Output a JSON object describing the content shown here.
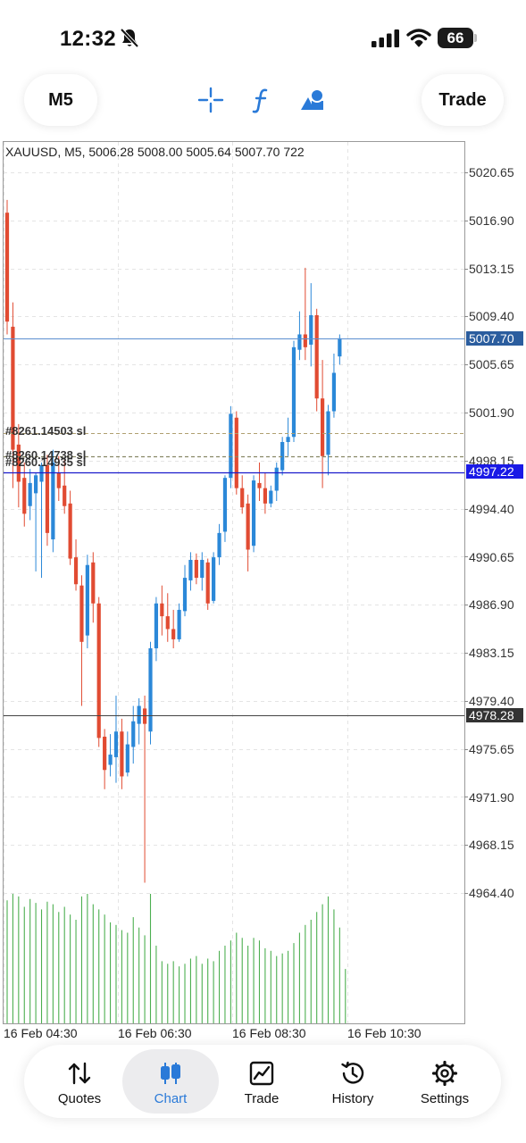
{
  "status_bar": {
    "time": "12:32",
    "battery": "66",
    "icons": [
      "bell-slash-icon",
      "signal-icon",
      "wifi-icon",
      "battery-icon"
    ]
  },
  "toolbar": {
    "timeframe": "M5",
    "trade_label": "Trade",
    "tools": [
      "crosshair-icon",
      "indicator-icon",
      "objects-icon"
    ],
    "accent": "#2a7ad8"
  },
  "chart": {
    "header": "XAUUSD, M5, 5006.28 5008.00 5005.64 5007.70 722",
    "price_levels": [
      "5020.65",
      "5016.90",
      "5013.15",
      "5009.40",
      "5005.65",
      "5001.90",
      "4998.15",
      "4994.40",
      "4990.65",
      "4986.90",
      "4983.15",
      "4979.40",
      "4975.65",
      "4971.90",
      "4968.15",
      "4964.40"
    ],
    "bid_price": "5007.70",
    "order_price": "4997.22",
    "stop_price": "4978.28",
    "time_labels": [
      "16 Feb 04:30",
      "16 Feb 06:30",
      "16 Feb 08:30",
      "16 Feb 10:30"
    ],
    "order_labels": [
      "#8261.14503 sl",
      "#8260.14738 sl",
      "#8260.14935 sl"
    ],
    "colors": {
      "bull": "#2b88d8",
      "bear": "#e14b32",
      "volume": "#4caf50",
      "bid_line": "#5b8fd0",
      "order_line": "#1a1acc",
      "stop_line": "#444444",
      "order_tag": "#1a1ae6",
      "bid_tag": "#2b5d9e",
      "stop_tag": "#333333"
    }
  },
  "chart_data": {
    "type": "candlestick",
    "symbol": "XAUUSD",
    "timeframe": "M5",
    "ohlc_last": {
      "open": 5006.28,
      "high": 5008.0,
      "low": 5005.64,
      "close": 5007.7,
      "volume": 722
    },
    "ylim": [
      4962.0,
      5024.0
    ],
    "candles": [
      {
        "o": 5017.5,
        "h": 5018.5,
        "c": 5009.0,
        "l": 5008.0
      },
      {
        "o": 5008.6,
        "h": 5010.5,
        "c": 4999.0,
        "l": 4996.0
      },
      {
        "o": 4999.4,
        "h": 5001.0,
        "c": 4996.5,
        "l": 4994.5
      },
      {
        "o": 4996.8,
        "h": 4998.0,
        "c": 4994.0,
        "l": 4993.0
      },
      {
        "o": 4994.6,
        "h": 4997.5,
        "c": 4996.4,
        "l": 4993.5
      },
      {
        "o": 4995.6,
        "h": 4997.2,
        "c": 4997.0,
        "l": 4989.5
      },
      {
        "o": 4996.5,
        "h": 4998.0,
        "c": 4997.8,
        "l": 4989.0
      },
      {
        "o": 4997.8,
        "h": 4998.6,
        "c": 4992.5,
        "l": 4991.5
      },
      {
        "o": 4992.0,
        "h": 4999.0,
        "c": 4998.0,
        "l": 4991.0
      },
      {
        "o": 4997.2,
        "h": 4998.5,
        "c": 4996.0,
        "l": 4995.0
      },
      {
        "o": 4996.2,
        "h": 4998.2,
        "c": 4994.6,
        "l": 4994.0
      },
      {
        "o": 4994.8,
        "h": 4995.8,
        "c": 4990.5,
        "l": 4990.0
      },
      {
        "o": 4990.6,
        "h": 4992.0,
        "c": 4988.5,
        "l": 4988.0
      },
      {
        "o": 4988.4,
        "h": 4989.2,
        "c": 4984.0,
        "l": 4979.0
      },
      {
        "o": 4984.5,
        "h": 4990.8,
        "c": 4990.0,
        "l": 4983.5
      },
      {
        "o": 4990.2,
        "h": 4991.0,
        "c": 4987.0,
        "l": 4985.5
      },
      {
        "o": 4987.0,
        "h": 4987.5,
        "c": 4976.5,
        "l": 4975.8
      },
      {
        "o": 4976.6,
        "h": 4977.2,
        "c": 4974.0,
        "l": 4972.5
      },
      {
        "o": 4974.4,
        "h": 4976.8,
        "c": 4975.2,
        "l": 4973.5
      },
      {
        "o": 4975.0,
        "h": 4979.8,
        "c": 4977.0,
        "l": 4973.0
      },
      {
        "o": 4977.0,
        "h": 4978.0,
        "c": 4973.5,
        "l": 4972.5
      },
      {
        "o": 4973.8,
        "h": 4977.0,
        "c": 4976.0,
        "l": 4973.5
      },
      {
        "o": 4975.8,
        "h": 4979.0,
        "c": 4977.8,
        "l": 4974.5
      },
      {
        "o": 4977.6,
        "h": 4979.6,
        "c": 4979.0,
        "l": 4976.0
      },
      {
        "o": 4978.8,
        "h": 4979.8,
        "c": 4977.6,
        "l": 4965.2
      },
      {
        "o": 4977.0,
        "h": 4984.0,
        "c": 4983.5,
        "l": 4976.0
      },
      {
        "o": 4983.5,
        "h": 4987.5,
        "c": 4987.0,
        "l": 4982.5
      },
      {
        "o": 4987.0,
        "h": 4988.4,
        "c": 4986.0,
        "l": 4984.5
      },
      {
        "o": 4986.0,
        "h": 4987.8,
        "c": 4985.0,
        "l": 4984.0
      },
      {
        "o": 4985.0,
        "h": 4986.5,
        "c": 4984.2,
        "l": 4983.5
      },
      {
        "o": 4984.2,
        "h": 4987.0,
        "c": 4986.5,
        "l": 4984.0
      },
      {
        "o": 4986.4,
        "h": 4990.0,
        "c": 4989.0,
        "l": 4986.0
      },
      {
        "o": 4988.8,
        "h": 4991.0,
        "c": 4990.4,
        "l": 4988.0
      },
      {
        "o": 4990.4,
        "h": 4990.9,
        "c": 4989.0,
        "l": 4988.5
      },
      {
        "o": 4989.0,
        "h": 4991.0,
        "c": 4990.4,
        "l": 4988.0
      },
      {
        "o": 4990.2,
        "h": 4990.5,
        "c": 4987.0,
        "l": 4986.5
      },
      {
        "o": 4987.2,
        "h": 4991.0,
        "c": 4990.6,
        "l": 4987.0
      },
      {
        "o": 4990.6,
        "h": 4993.2,
        "c": 4992.5,
        "l": 4990.0
      },
      {
        "o": 4992.6,
        "h": 4997.0,
        "c": 4996.8,
        "l": 4991.8
      },
      {
        "o": 4996.8,
        "h": 5002.4,
        "c": 5001.8,
        "l": 4996.0
      },
      {
        "o": 5001.5,
        "h": 5002.0,
        "c": 4996.0,
        "l": 4995.5
      },
      {
        "o": 4996.0,
        "h": 4997.0,
        "c": 4994.5,
        "l": 4994.0
      },
      {
        "o": 4994.8,
        "h": 4995.5,
        "c": 4991.2,
        "l": 4989.5
      },
      {
        "o": 4991.5,
        "h": 4997.0,
        "c": 4996.6,
        "l": 4991.0
      },
      {
        "o": 4996.4,
        "h": 4998.0,
        "c": 4996.0,
        "l": 4995.0
      },
      {
        "o": 4996.0,
        "h": 4997.2,
        "c": 4994.8,
        "l": 4994.0
      },
      {
        "o": 4994.8,
        "h": 4996.2,
        "c": 4995.8,
        "l": 4994.5
      },
      {
        "o": 4995.8,
        "h": 4998.0,
        "c": 4997.6,
        "l": 4995.0
      },
      {
        "o": 4997.4,
        "h": 5000.0,
        "c": 4999.6,
        "l": 4997.0
      },
      {
        "o": 4999.6,
        "h": 5001.5,
        "c": 5000.0,
        "l": 4998.5
      },
      {
        "o": 5000.0,
        "h": 5007.5,
        "c": 5007.0,
        "l": 4999.6
      },
      {
        "o": 5006.8,
        "h": 5009.8,
        "c": 5008.0,
        "l": 5006.0
      },
      {
        "o": 5008.0,
        "h": 5013.2,
        "c": 5007.0,
        "l": 5006.0
      },
      {
        "o": 5007.2,
        "h": 5012.0,
        "c": 5009.5,
        "l": 5005.5
      },
      {
        "o": 5009.5,
        "h": 5010.0,
        "c": 5003.0,
        "l": 5002.0
      },
      {
        "o": 5003.0,
        "h": 5006.0,
        "c": 4998.5,
        "l": 4996.0
      },
      {
        "o": 4998.6,
        "h": 5002.5,
        "c": 5002.0,
        "l": 4997.0
      },
      {
        "o": 5002.0,
        "h": 5006.5,
        "c": 5005.0,
        "l": 5001.5
      },
      {
        "o": 5006.28,
        "h": 5008.0,
        "c": 5007.7,
        "l": 5005.64
      }
    ],
    "volume": [
      95,
      100,
      98,
      90,
      96,
      93,
      88,
      94,
      92,
      86,
      90,
      84,
      80,
      98,
      100,
      92,
      88,
      84,
      78,
      76,
      72,
      70,
      82,
      74,
      68,
      100,
      60,
      48,
      46,
      48,
      44,
      46,
      50,
      52,
      46,
      50,
      48,
      56,
      60,
      64,
      70,
      66,
      60,
      66,
      64,
      58,
      56,
      52,
      54,
      56,
      62,
      70,
      76,
      80,
      86,
      92,
      98,
      88,
      74,
      42
    ],
    "price_ticks": [
      5020.65,
      5016.9,
      5013.15,
      5009.4,
      5005.65,
      5001.9,
      4998.15,
      4994.4,
      4990.65,
      4986.9,
      4983.15,
      4979.4,
      4975.65,
      4971.9,
      4968.15,
      4964.4
    ],
    "horizontal_lines": [
      {
        "name": "bid",
        "price": 5007.7
      },
      {
        "name": "order",
        "price": 4997.22
      },
      {
        "name": "stop",
        "price": 4978.28
      },
      {
        "name": "sl-a",
        "price": 5000.3
      },
      {
        "name": "sl-b",
        "price": 4998.5
      }
    ],
    "x_labels": [
      "16 Feb 04:30",
      "16 Feb 06:30",
      "16 Feb 08:30",
      "16 Feb 10:30"
    ],
    "grid": true
  },
  "tabbar": {
    "tabs": [
      {
        "label": "Quotes",
        "icon": "quotes-icon",
        "active": false
      },
      {
        "label": "Chart",
        "icon": "chart-icon",
        "active": true
      },
      {
        "label": "Trade",
        "icon": "trade-icon",
        "active": false
      },
      {
        "label": "History",
        "icon": "history-icon",
        "active": false
      },
      {
        "label": "Settings",
        "icon": "settings-icon",
        "active": false
      }
    ]
  }
}
